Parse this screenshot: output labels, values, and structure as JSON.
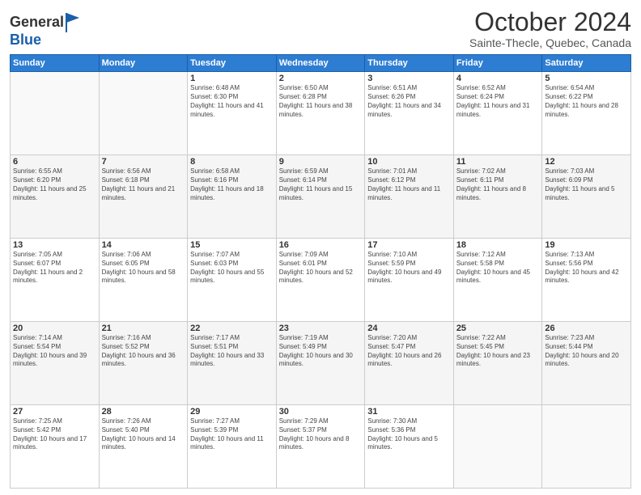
{
  "header": {
    "logo_line1": "General",
    "logo_line2": "Blue",
    "month": "October 2024",
    "location": "Sainte-Thecle, Quebec, Canada"
  },
  "days_of_week": [
    "Sunday",
    "Monday",
    "Tuesday",
    "Wednesday",
    "Thursday",
    "Friday",
    "Saturday"
  ],
  "weeks": [
    [
      {
        "day": "",
        "info": ""
      },
      {
        "day": "",
        "info": ""
      },
      {
        "day": "1",
        "info": "Sunrise: 6:48 AM\nSunset: 6:30 PM\nDaylight: 11 hours and 41 minutes."
      },
      {
        "day": "2",
        "info": "Sunrise: 6:50 AM\nSunset: 6:28 PM\nDaylight: 11 hours and 38 minutes."
      },
      {
        "day": "3",
        "info": "Sunrise: 6:51 AM\nSunset: 6:26 PM\nDaylight: 11 hours and 34 minutes."
      },
      {
        "day": "4",
        "info": "Sunrise: 6:52 AM\nSunset: 6:24 PM\nDaylight: 11 hours and 31 minutes."
      },
      {
        "day": "5",
        "info": "Sunrise: 6:54 AM\nSunset: 6:22 PM\nDaylight: 11 hours and 28 minutes."
      }
    ],
    [
      {
        "day": "6",
        "info": "Sunrise: 6:55 AM\nSunset: 6:20 PM\nDaylight: 11 hours and 25 minutes."
      },
      {
        "day": "7",
        "info": "Sunrise: 6:56 AM\nSunset: 6:18 PM\nDaylight: 11 hours and 21 minutes."
      },
      {
        "day": "8",
        "info": "Sunrise: 6:58 AM\nSunset: 6:16 PM\nDaylight: 11 hours and 18 minutes."
      },
      {
        "day": "9",
        "info": "Sunrise: 6:59 AM\nSunset: 6:14 PM\nDaylight: 11 hours and 15 minutes."
      },
      {
        "day": "10",
        "info": "Sunrise: 7:01 AM\nSunset: 6:12 PM\nDaylight: 11 hours and 11 minutes."
      },
      {
        "day": "11",
        "info": "Sunrise: 7:02 AM\nSunset: 6:11 PM\nDaylight: 11 hours and 8 minutes."
      },
      {
        "day": "12",
        "info": "Sunrise: 7:03 AM\nSunset: 6:09 PM\nDaylight: 11 hours and 5 minutes."
      }
    ],
    [
      {
        "day": "13",
        "info": "Sunrise: 7:05 AM\nSunset: 6:07 PM\nDaylight: 11 hours and 2 minutes."
      },
      {
        "day": "14",
        "info": "Sunrise: 7:06 AM\nSunset: 6:05 PM\nDaylight: 10 hours and 58 minutes."
      },
      {
        "day": "15",
        "info": "Sunrise: 7:07 AM\nSunset: 6:03 PM\nDaylight: 10 hours and 55 minutes."
      },
      {
        "day": "16",
        "info": "Sunrise: 7:09 AM\nSunset: 6:01 PM\nDaylight: 10 hours and 52 minutes."
      },
      {
        "day": "17",
        "info": "Sunrise: 7:10 AM\nSunset: 5:59 PM\nDaylight: 10 hours and 49 minutes."
      },
      {
        "day": "18",
        "info": "Sunrise: 7:12 AM\nSunset: 5:58 PM\nDaylight: 10 hours and 45 minutes."
      },
      {
        "day": "19",
        "info": "Sunrise: 7:13 AM\nSunset: 5:56 PM\nDaylight: 10 hours and 42 minutes."
      }
    ],
    [
      {
        "day": "20",
        "info": "Sunrise: 7:14 AM\nSunset: 5:54 PM\nDaylight: 10 hours and 39 minutes."
      },
      {
        "day": "21",
        "info": "Sunrise: 7:16 AM\nSunset: 5:52 PM\nDaylight: 10 hours and 36 minutes."
      },
      {
        "day": "22",
        "info": "Sunrise: 7:17 AM\nSunset: 5:51 PM\nDaylight: 10 hours and 33 minutes."
      },
      {
        "day": "23",
        "info": "Sunrise: 7:19 AM\nSunset: 5:49 PM\nDaylight: 10 hours and 30 minutes."
      },
      {
        "day": "24",
        "info": "Sunrise: 7:20 AM\nSunset: 5:47 PM\nDaylight: 10 hours and 26 minutes."
      },
      {
        "day": "25",
        "info": "Sunrise: 7:22 AM\nSunset: 5:45 PM\nDaylight: 10 hours and 23 minutes."
      },
      {
        "day": "26",
        "info": "Sunrise: 7:23 AM\nSunset: 5:44 PM\nDaylight: 10 hours and 20 minutes."
      }
    ],
    [
      {
        "day": "27",
        "info": "Sunrise: 7:25 AM\nSunset: 5:42 PM\nDaylight: 10 hours and 17 minutes."
      },
      {
        "day": "28",
        "info": "Sunrise: 7:26 AM\nSunset: 5:40 PM\nDaylight: 10 hours and 14 minutes."
      },
      {
        "day": "29",
        "info": "Sunrise: 7:27 AM\nSunset: 5:39 PM\nDaylight: 10 hours and 11 minutes."
      },
      {
        "day": "30",
        "info": "Sunrise: 7:29 AM\nSunset: 5:37 PM\nDaylight: 10 hours and 8 minutes."
      },
      {
        "day": "31",
        "info": "Sunrise: 7:30 AM\nSunset: 5:36 PM\nDaylight: 10 hours and 5 minutes."
      },
      {
        "day": "",
        "info": ""
      },
      {
        "day": "",
        "info": ""
      }
    ]
  ]
}
